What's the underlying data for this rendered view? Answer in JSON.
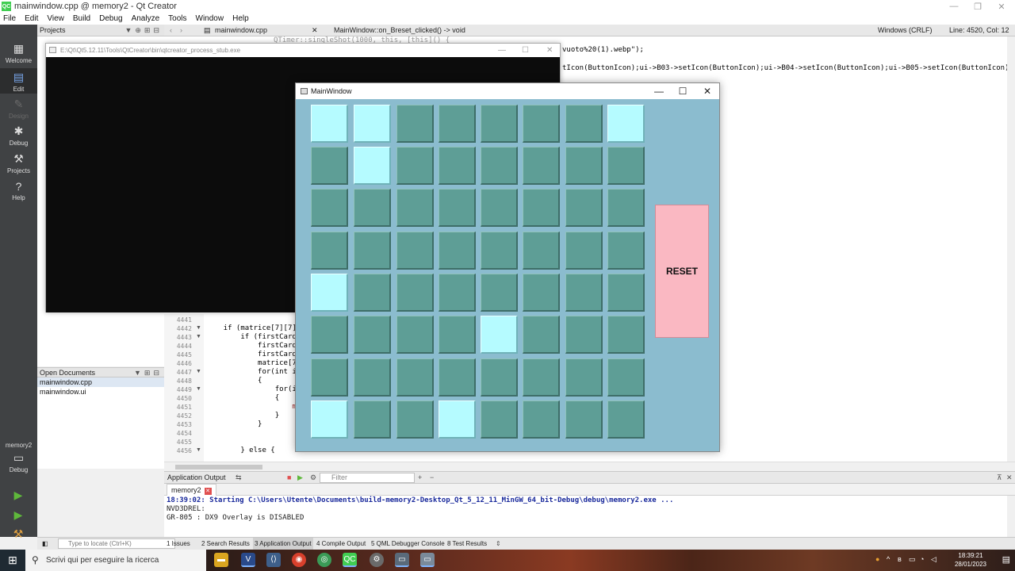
{
  "window": {
    "title": "mainwindow.cpp @ memory2 - Qt Creator",
    "app_icon": "QC"
  },
  "menu": [
    "File",
    "Edit",
    "View",
    "Build",
    "Debug",
    "Analyze",
    "Tools",
    "Window",
    "Help"
  ],
  "modes": {
    "welcome": "Welcome",
    "edit": "Edit",
    "design": "Design",
    "debug": "Debug",
    "projects": "Projects",
    "help": "Help",
    "kit_project": "memory2",
    "kit_config": "Debug"
  },
  "projects_pane": {
    "title": "Projects"
  },
  "open_documents": {
    "title": "Open Documents",
    "files": [
      "mainwindow.cpp",
      "mainwindow.ui"
    ]
  },
  "editor_toolbar": {
    "file": "mainwindow.cpp",
    "function": "MainWindow::on_Breset_clicked() -> void",
    "line_ending": "Windows (CRLF)",
    "position": "Line: 4520, Col: 12"
  },
  "editor": {
    "top_partial": "QTimer::singleShot(1000, this, [this]() {",
    "line1_right": "vuoto%20(1).webp\");",
    "line2_right": "tIcon(ButtonIcon);ui->B03->setIcon(ButtonIcon);ui->B04->setIcon(ButtonIcon);ui->B05->setIcon(ButtonIcon);",
    "line_numbers": [
      "4441",
      "4442",
      "4443",
      "4444",
      "4445",
      "4446",
      "4447",
      "4448",
      "4449",
      "4450",
      "4451",
      "4452",
      "4453",
      "4454",
      "4455",
      "4456"
    ],
    "lines": [
      "",
      "    if (matrice[7][7]",
      "        if (firstCard",
      "            firstCard",
      "            firstCard",
      "            matrice[7",
      "            for(int i",
      "            {",
      "                for(i",
      "                {",
      "                    m",
      "                }",
      "            }",
      "",
      "",
      "        } else {"
    ]
  },
  "output": {
    "pane_title": "Application Output",
    "filter_placeholder": "Filter",
    "tab": "memory2",
    "lines": [
      "18:39:02: Starting C:\\Users\\Utente\\Documents\\build-memory2-Desktop_Qt_5_12_11_MinGW_64_bit-Debug\\debug\\memory2.exe ...",
      "NVD3DREL:",
      "GR-805 : DX9 Overlay is DISABLED"
    ]
  },
  "statusbar": {
    "locate_placeholder": "Type to locate (Ctrl+K)",
    "tabs": [
      "1  Issues",
      "2  Search Results",
      "3  Application Output",
      "4  Compile Output",
      "5  QML Debugger Console",
      "8  Test Results"
    ]
  },
  "console_window": {
    "title": "E:\\Qt\\Qt5.12.11\\Tools\\QtCreator\\bin\\qtcreator_process_stub.exe"
  },
  "game": {
    "title": "MainWindow",
    "reset_label": "RESET",
    "face_down_color": "#5e9e96",
    "face_up_color": "#b5fbff",
    "board_color": "#8bbccf",
    "reset_color": "#fab8c2",
    "grid": [
      [
        1,
        1,
        0,
        0,
        0,
        0,
        0,
        1
      ],
      [
        0,
        1,
        0,
        0,
        0,
        0,
        0,
        0
      ],
      [
        0,
        0,
        0,
        0,
        0,
        0,
        0,
        0
      ],
      [
        0,
        0,
        0,
        0,
        0,
        0,
        0,
        0
      ],
      [
        1,
        0,
        0,
        0,
        0,
        0,
        0,
        0
      ],
      [
        0,
        0,
        0,
        0,
        1,
        0,
        0,
        0
      ],
      [
        0,
        0,
        0,
        0,
        0,
        0,
        0,
        0
      ],
      [
        1,
        0,
        0,
        1,
        0,
        0,
        0,
        0
      ]
    ]
  },
  "taskbar": {
    "search_placeholder": "Scrivi qui per eseguire la ricerca",
    "time": "18:39:21",
    "date": "28/01/2023"
  }
}
